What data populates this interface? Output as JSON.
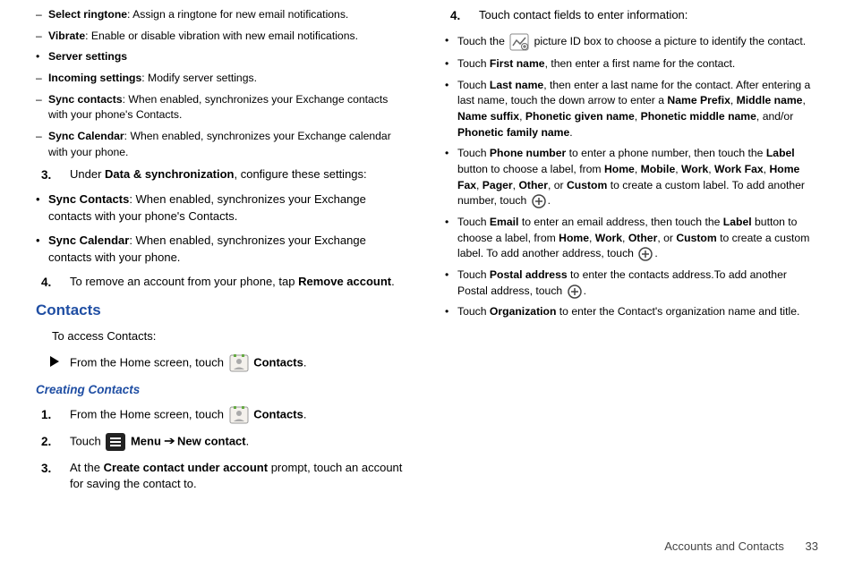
{
  "left": {
    "select_ringtone_b": "Select ringtone",
    "select_ringtone_t": ": Assign a ringtone for new email notifications.",
    "vibrate_b": "Vibrate",
    "vibrate_t": ": Enable or disable vibration with new email notifications.",
    "server_settings": "Server settings",
    "incoming_b": "Incoming settings",
    "incoming_t": ": Modify server settings.",
    "sync_contacts_b": "Sync contacts",
    "sync_contacts_t": ": When enabled, synchronizes your Exchange contacts with your phone's Contacts.",
    "sync_calendar_b": "Sync Calendar",
    "sync_calendar_t": ": When enabled, synchronizes your Exchange calendar with your phone.",
    "step3_pre": "Under ",
    "step3_b": "Data & synchronization",
    "step3_post": ", configure these settings:",
    "s3_sync_contacts_b": "Sync Contacts",
    "s3_sync_contacts_t": ": When enabled, synchronizes your Exchange contacts with your phone's Contacts.",
    "s3_sync_calendar_b": "Sync Calendar",
    "s3_sync_calendar_t": ": When enabled, synchronizes your Exchange contacts with your phone.",
    "step4_pre": "To remove an account from your phone, tap ",
    "step4_b": "Remove account",
    "step4_post": ".",
    "contacts_h": "Contacts",
    "access_lead": "To access Contacts:",
    "from_home_pre": "From the Home screen, touch ",
    "contacts_label": "Contacts",
    "period": ".",
    "creating_h": "Creating Contacts",
    "step2_touch": "Touch ",
    "menu_label": "Menu",
    "arrow_sep": "➔",
    "new_contact": "New contact",
    "step3b_pre": "At the ",
    "step3b_b": "Create contact under account",
    "step3b_post": " prompt, touch an account for saving the contact to."
  },
  "right": {
    "step4_lead": "Touch contact fields to enter information:",
    "pic_pre": "Touch the ",
    "pic_post": " picture ID box to choose a picture to identify the contact.",
    "fn_pre": "Touch ",
    "fn_b": "First name",
    "fn_post": ", then enter a first name for the contact.",
    "ln_pre": "Touch ",
    "ln_b": "Last name",
    "ln_mid": ", then enter a last name for the contact. After entering a last name, touch the down arrow to enter a ",
    "ln_b2": "Name Prefix",
    "ln_c": ", ",
    "ln_b3": "Middle name",
    "ln_b4": "Name suffix",
    "ln_b5": "Phonetic given name",
    "ln_b6": "Phonetic middle name",
    "ln_and": ", and/or ",
    "ln_b7": "Phonetic family name",
    "pn_pre": "Touch ",
    "pn_b": "Phone number",
    "pn_mid": " to enter a phone number, then touch the ",
    "pn_label_b": "Label",
    "pn_mid2": " button to choose a label, from ",
    "pn_home": "Home",
    "pn_mobile": "Mobile",
    "pn_work": "Work",
    "pn_workfax": "Work Fax",
    "pn_homefax": "Home Fax",
    "pn_pager": "Pager",
    "pn_other": "Other",
    "pn_or": ", or ",
    "pn_custom": "Custom",
    "pn_post": " to create a custom label. To add another number, touch ",
    "em_pre": "Touch ",
    "em_b": "Email",
    "em_mid": " to enter an email address, then touch the ",
    "em_label_b": "Label",
    "em_mid2": " button to choose a label, from ",
    "em_home": "Home",
    "em_work": "Work",
    "em_other": "Other",
    "em_or": ", or ",
    "em_custom": "Custom",
    "em_post": " to create a custom label. To add another address, touch ",
    "pa_pre": "Touch ",
    "pa_b": "Postal address",
    "pa_mid": " to enter the contacts address.To add another Postal address, touch ",
    "org_pre": "Touch ",
    "org_b": "Organization",
    "org_post": " to enter the Contact's organization name and title."
  },
  "footer": {
    "section": "Accounts and Contacts",
    "page": "33"
  }
}
